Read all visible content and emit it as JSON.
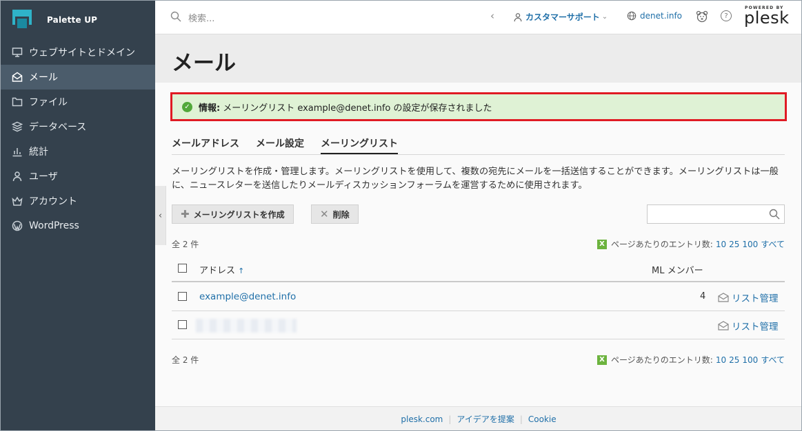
{
  "brand": {
    "name": "Palette UP"
  },
  "sidebar": {
    "items": [
      {
        "label": "ウェブサイトとドメイン",
        "icon": "monitor-icon"
      },
      {
        "label": "メール",
        "icon": "envelope-icon",
        "active": true
      },
      {
        "label": "ファイル",
        "icon": "folder-icon"
      },
      {
        "label": "データベース",
        "icon": "database-icon"
      },
      {
        "label": "統計",
        "icon": "chart-icon"
      },
      {
        "label": "ユーザ",
        "icon": "user-icon"
      },
      {
        "label": "アカウント",
        "icon": "crown-icon"
      },
      {
        "label": "WordPress",
        "icon": "wordpress-icon"
      }
    ]
  },
  "topbar": {
    "search_placeholder": "検索...",
    "support_label": "カスタマーサポート",
    "domain_label": "denet.info",
    "powered_by": "POWERED BY",
    "product": "plesk"
  },
  "page": {
    "title": "メール"
  },
  "alert": {
    "prefix": "情報:",
    "message": "メーリングリスト example@denet.info の設定が保存されました",
    "color": "#e01b24"
  },
  "tabs": [
    {
      "label": "メールアドレス"
    },
    {
      "label": "メール設定"
    },
    {
      "label": "メーリングリスト",
      "active": true
    }
  ],
  "description": "メーリングリストを作成・管理します。メーリングリストを使用して、複数の宛先にメールを一括送信することができます。メーリングリストは一般に、ニュースレターを送信したりメールディスカッションフォーラムを運営するために使用されます。",
  "toolbar": {
    "create_label": "メーリングリストを作成",
    "delete_label": "削除"
  },
  "list": {
    "total": "全 2 件",
    "per_page_label": "ページあたりのエントリ数:",
    "per_page_options": [
      "10",
      "25",
      "100",
      "すべて"
    ],
    "columns": {
      "address": "アドレス",
      "members": "ML メンバー"
    },
    "sort_arrow": "↑",
    "rows": [
      {
        "address": "example@denet.info",
        "members": "4",
        "action": "リスト管理"
      },
      {
        "address": "",
        "members": "",
        "action": "リスト管理"
      }
    ]
  },
  "footer": {
    "links": [
      "plesk.com",
      "アイデアを提案",
      "Cookie"
    ]
  }
}
